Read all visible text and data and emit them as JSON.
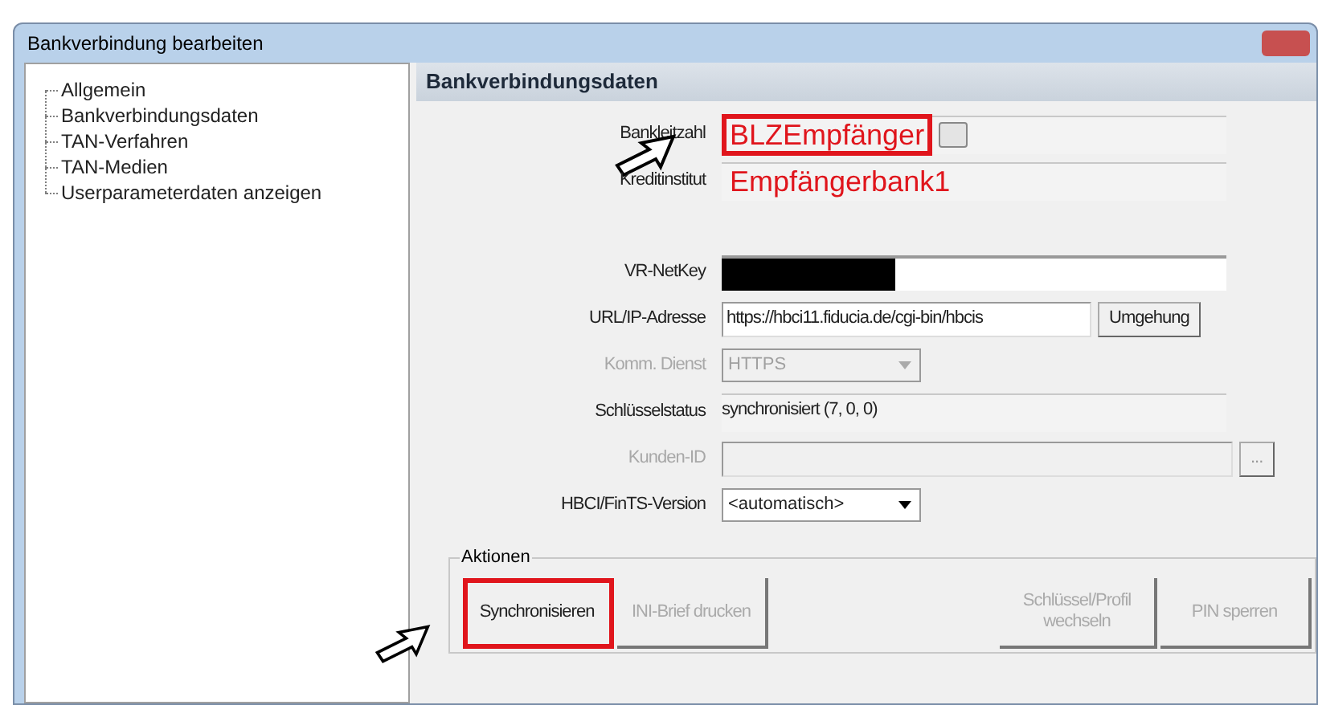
{
  "window": {
    "title": "Bankverbindung bearbeiten"
  },
  "sidebar": {
    "items": [
      {
        "label": "Allgemein",
        "selected": false
      },
      {
        "label": "Bankverbindungsdaten",
        "selected": false
      },
      {
        "label": "TAN-Verfahren",
        "selected": false
      },
      {
        "label": "TAN-Medien",
        "selected": false
      },
      {
        "label": "Userparameterdaten anzeigen",
        "selected": false
      }
    ]
  },
  "panel": {
    "title": "Bankverbindungsdaten",
    "fields": [
      {
        "kind": "annotated",
        "label": "Bankleitzahl",
        "value": "BLZEmpfänger",
        "highlighted": true,
        "pointer": true
      },
      {
        "kind": "annotated",
        "label": "Kreditinstitut",
        "value": "Empfängerbank1",
        "highlighted": false,
        "pointer": false
      },
      {
        "kind": "gap"
      },
      {
        "kind": "redacted",
        "label": "VR-NetKey"
      },
      {
        "kind": "text",
        "label": "URL/IP-Adresse",
        "value": "https://hbci11.fiducia.de/cgi-bin/hbcis",
        "button": "Umgehung",
        "disabled": false
      },
      {
        "kind": "dropdown",
        "label": "Komm. Dienst",
        "value": "HTTPS",
        "disabled": true
      },
      {
        "kind": "readonly",
        "label": "Schlüsselstatus",
        "value": "synchronisiert (7, 0, 0)"
      },
      {
        "kind": "text",
        "label": "Kunden-ID",
        "button": "...",
        "disabled": true
      },
      {
        "kind": "dropdown",
        "label": "HBCI/FinTS-Version",
        "value": "<automatisch>",
        "disabled": false
      }
    ],
    "actions": {
      "title": "Aktionen",
      "buttons": [
        {
          "label": "Synchronisieren",
          "disabled": false,
          "highlighted": true
        },
        {
          "label": "INI-Brief drucken",
          "disabled": true,
          "highlighted": false
        },
        {
          "label": "Schlüssel/Profil wechseln",
          "disabled": true,
          "highlighted": false
        },
        {
          "label": "PIN sperren",
          "disabled": true,
          "highlighted": false
        }
      ]
    }
  }
}
